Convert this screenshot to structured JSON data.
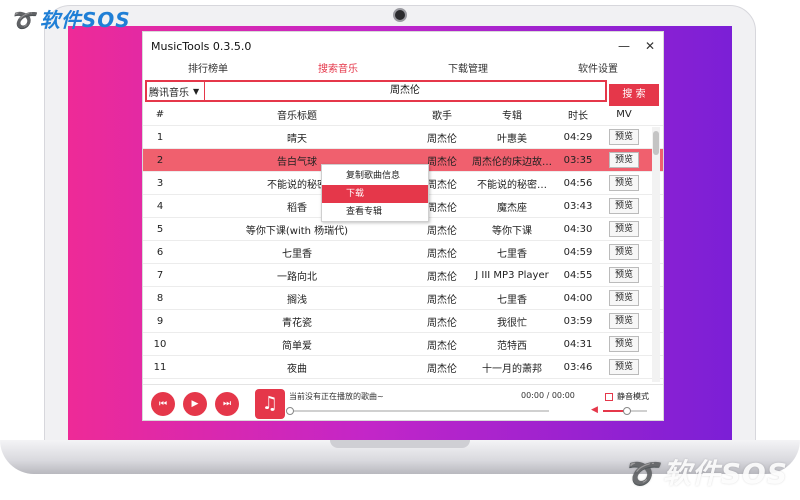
{
  "watermark": {
    "top_left": "软件SOS",
    "bottom_right": "软件SOS"
  },
  "window": {
    "title": "MusicTools 0.3.5.0",
    "minimize": "—",
    "close": "✕"
  },
  "tabs": [
    {
      "label": "排行榜单",
      "active": false
    },
    {
      "label": "搜索音乐",
      "active": true
    },
    {
      "label": "下载管理",
      "active": false
    },
    {
      "label": "软件设置",
      "active": false
    }
  ],
  "search": {
    "source": "腾讯音乐",
    "query": "周杰伦",
    "button": "搜 索"
  },
  "table": {
    "headers": {
      "num": "#",
      "title": "音乐标题",
      "artist": "歌手",
      "album": "专辑",
      "duration": "时长",
      "mv": "MV"
    },
    "rows": [
      {
        "num": "1",
        "title": "晴天",
        "artist": "周杰伦",
        "album": "叶惠美",
        "duration": "04:29",
        "mv": "预览"
      },
      {
        "num": "2",
        "title": "告白气球",
        "artist": "周杰伦",
        "album": "周杰伦的床边故…",
        "duration": "03:35",
        "mv": "预览"
      },
      {
        "num": "3",
        "title": "不能说的秘密",
        "artist": "周杰伦",
        "album": "不能说的秘密…",
        "duration": "04:56",
        "mv": "预览"
      },
      {
        "num": "4",
        "title": "稻香",
        "artist": "周杰伦",
        "album": "魔杰座",
        "duration": "03:43",
        "mv": "预览"
      },
      {
        "num": "5",
        "title": "等你下课(with 杨瑞代)",
        "artist": "周杰伦",
        "album": "等你下课",
        "duration": "04:30",
        "mv": "预览"
      },
      {
        "num": "6",
        "title": "七里香",
        "artist": "周杰伦",
        "album": "七里香",
        "duration": "04:59",
        "mv": "预览"
      },
      {
        "num": "7",
        "title": "一路向北",
        "artist": "周杰伦",
        "album": "J III MP3 Player",
        "duration": "04:55",
        "mv": "预览"
      },
      {
        "num": "8",
        "title": "搁浅",
        "artist": "周杰伦",
        "album": "七里香",
        "duration": "04:00",
        "mv": "预览"
      },
      {
        "num": "9",
        "title": "青花瓷",
        "artist": "周杰伦",
        "album": "我很忙",
        "duration": "03:59",
        "mv": "预览"
      },
      {
        "num": "10",
        "title": "简单爱",
        "artist": "周杰伦",
        "album": "范特西",
        "duration": "04:31",
        "mv": "预览"
      },
      {
        "num": "11",
        "title": "夜曲",
        "artist": "周杰伦",
        "album": "十一月的萧邦",
        "duration": "03:46",
        "mv": "预览"
      }
    ],
    "selected_row": "2"
  },
  "context_menu": [
    {
      "label": "复制歌曲信息",
      "hover": false
    },
    {
      "label": "下载",
      "hover": true
    },
    {
      "label": "查看专辑",
      "hover": false
    }
  ],
  "player": {
    "now_playing": "当前没有正在播放的歌曲~",
    "time": "00:00 / 00:00",
    "mute_label": "静音模式",
    "volume_fraction": 0.55,
    "colors": {
      "accent": "#e5374a"
    }
  }
}
